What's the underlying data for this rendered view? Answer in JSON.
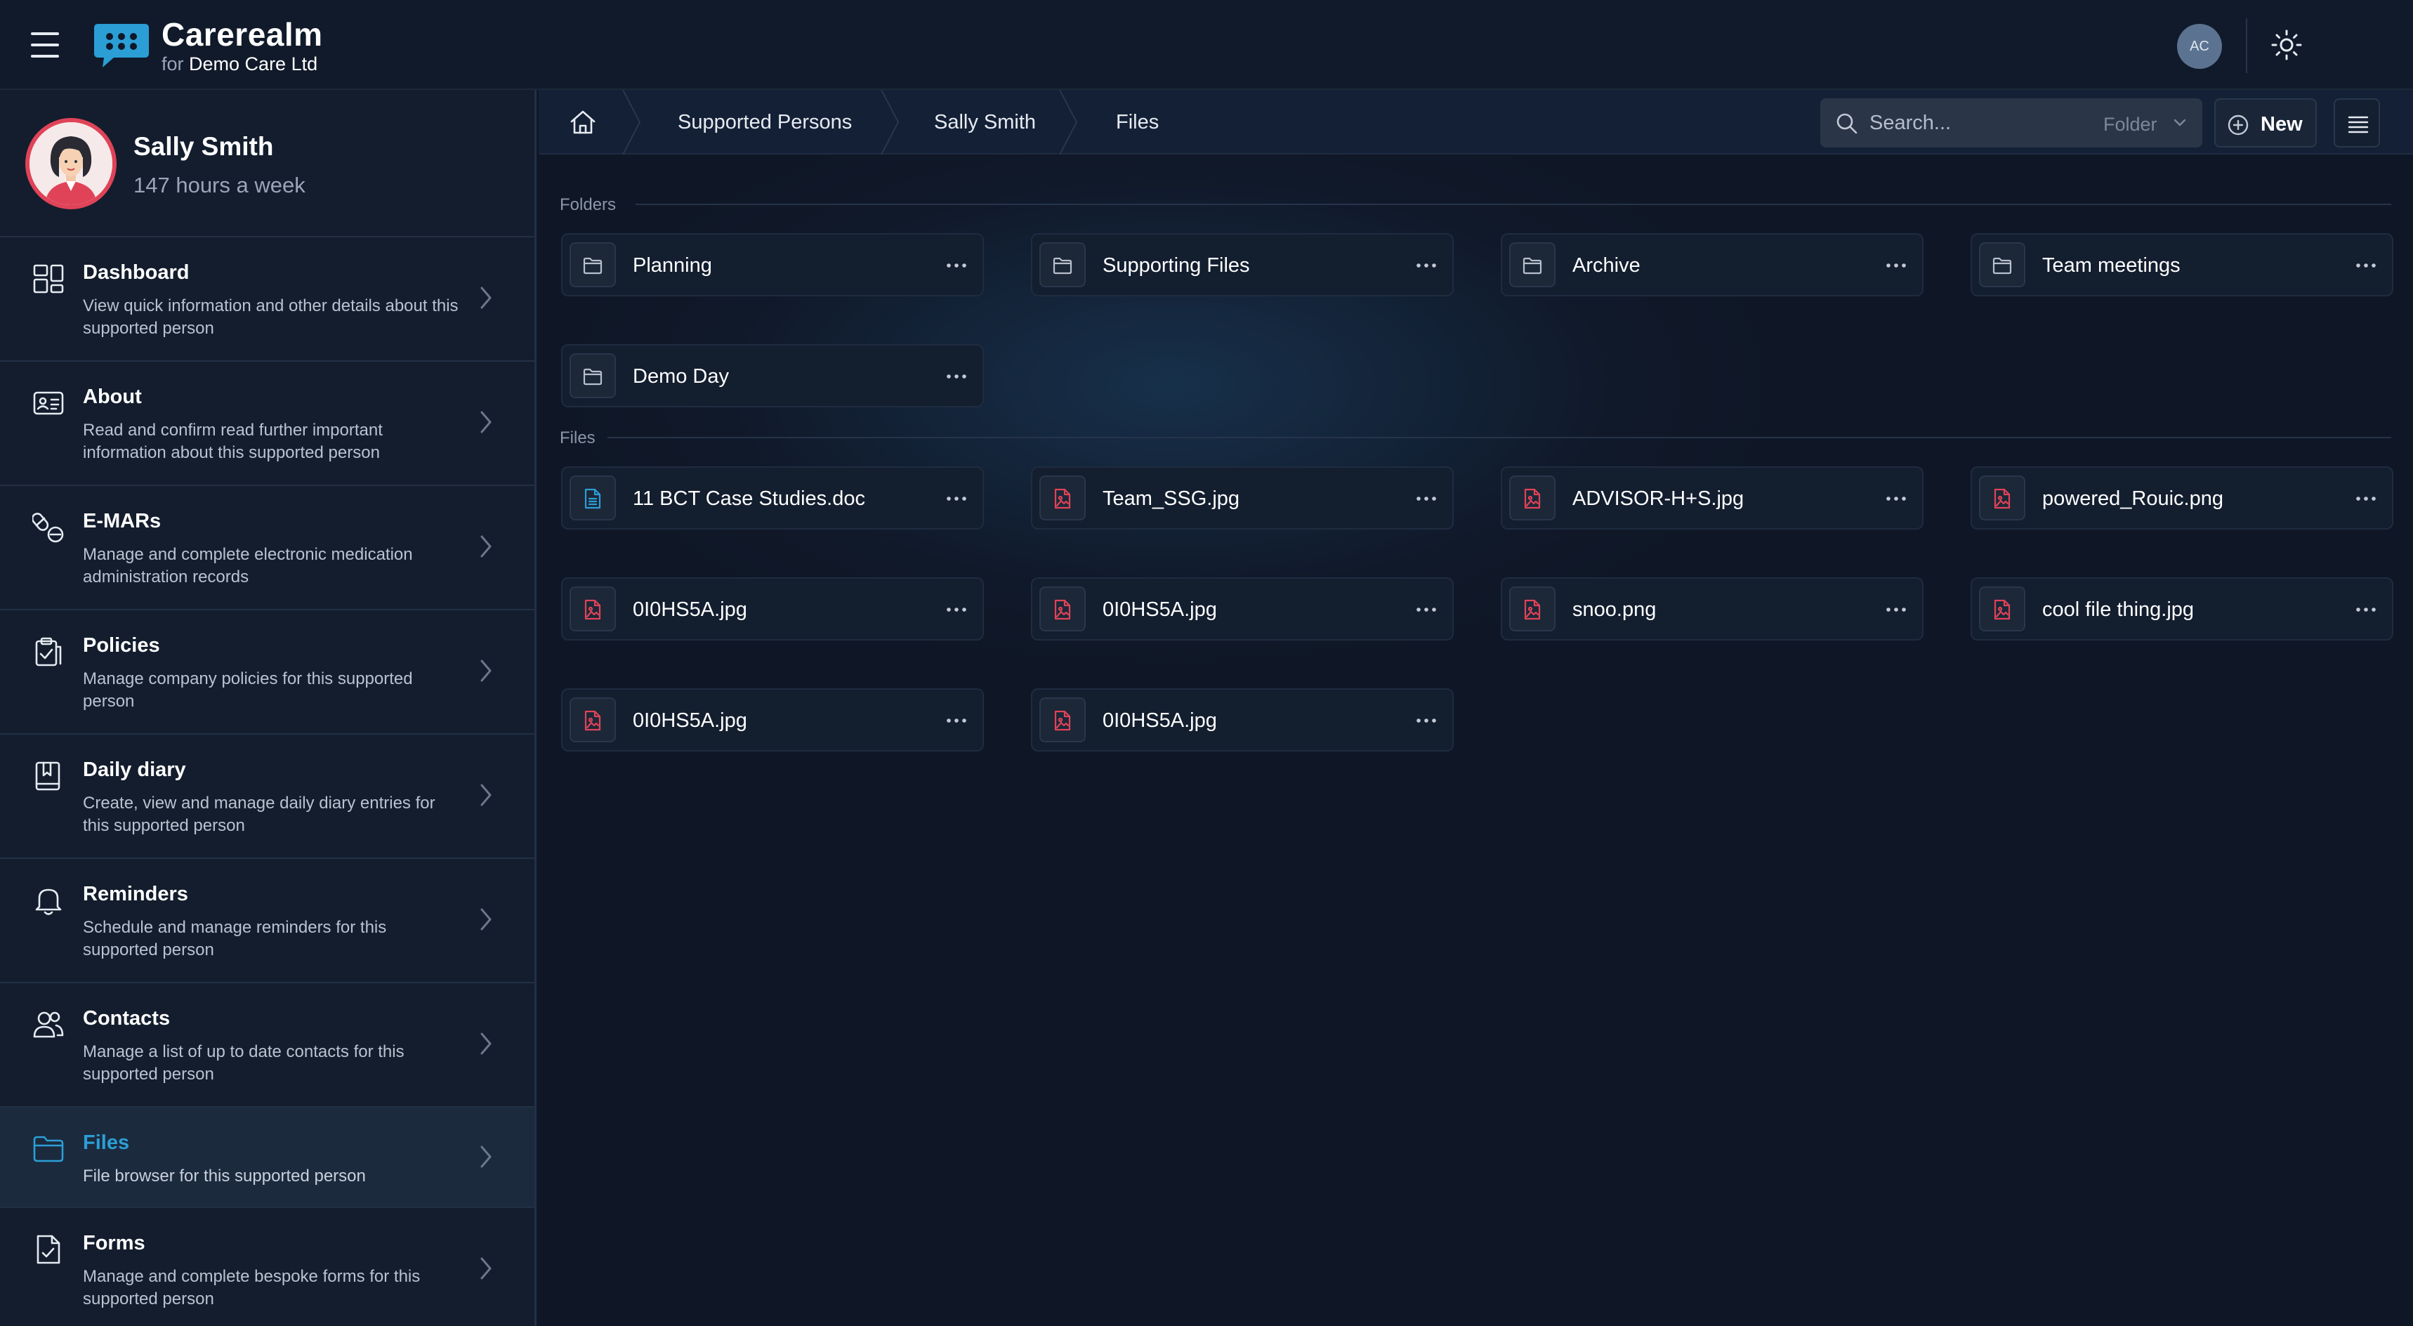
{
  "header": {
    "brand_name": "Carerealm",
    "brand_for": "for",
    "org_name": "Demo Care Ltd",
    "user_initials": "AC"
  },
  "profile": {
    "name": "Sally Smith",
    "hours": "147 hours a week"
  },
  "sidebar": {
    "items": [
      {
        "title": "Dashboard",
        "desc": "View quick information and other details about this supported person",
        "icon": "dashboard-icon"
      },
      {
        "title": "About",
        "desc": "Read and confirm read further important information about this supported person",
        "icon": "id-card-icon"
      },
      {
        "title": "E-MARs",
        "desc": "Manage and complete electronic medication administration records",
        "icon": "medication-icon"
      },
      {
        "title": "Policies",
        "desc": "Manage company policies for this supported person",
        "icon": "clipboard-icon"
      },
      {
        "title": "Daily diary",
        "desc": "Create, view and manage daily diary entries for this supported person",
        "icon": "book-icon"
      },
      {
        "title": "Reminders",
        "desc": "Schedule and manage reminders for this supported person",
        "icon": "bell-icon"
      },
      {
        "title": "Contacts",
        "desc": "Manage a list of up to date contacts for this supported person",
        "icon": "users-icon"
      },
      {
        "title": "Files",
        "desc": "File browser for this supported person",
        "icon": "folder-icon",
        "active": true
      },
      {
        "title": "Forms",
        "desc": "Manage and complete bespoke forms for this supported person",
        "icon": "form-icon"
      }
    ]
  },
  "breadcrumb": {
    "items": [
      "Supported Persons",
      "Sally Smith",
      "Files"
    ]
  },
  "toolbar": {
    "search_placeholder": "Search...",
    "search_scope": "Folder",
    "new_label": "New"
  },
  "folders": {
    "label": "Folders",
    "items": [
      "Planning",
      "Supporting Files",
      "Archive",
      "Team meetings",
      "Demo Day"
    ]
  },
  "files": {
    "label": "Files",
    "items": [
      {
        "name": "11 BCT Case Studies.doc",
        "type": "doc"
      },
      {
        "name": "Team_SSG.jpg",
        "type": "image"
      },
      {
        "name": "ADVISOR-H+S.jpg",
        "type": "image"
      },
      {
        "name": "powered_Rouic.png",
        "type": "image"
      },
      {
        "name": "0I0HS5A.jpg",
        "type": "image"
      },
      {
        "name": "0I0HS5A.jpg",
        "type": "image"
      },
      {
        "name": "snoo.png",
        "type": "image"
      },
      {
        "name": "cool file thing.jpg",
        "type": "image"
      },
      {
        "name": "0I0HS5A.jpg",
        "type": "image"
      },
      {
        "name": "0I0HS5A.jpg",
        "type": "image"
      }
    ]
  },
  "colors": {
    "accent": "#2b9ed6",
    "image_file": "#e04358",
    "doc_file": "#2b9ed6",
    "background": "#0f1828"
  }
}
